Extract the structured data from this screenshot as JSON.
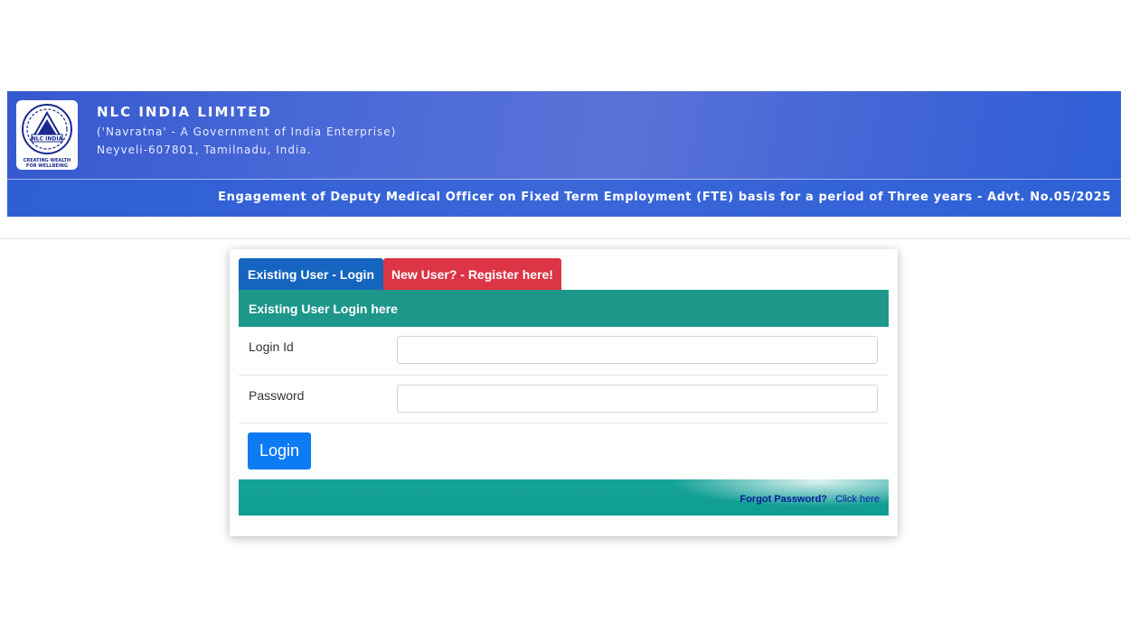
{
  "header": {
    "logo_icon": "nlc-india-logo",
    "logo_text": "NLC INDIA",
    "logo_tagline_top": "CREATING WEALTH",
    "logo_tagline_bottom": "FOR WELLBEING",
    "org_name": "NLC INDIA LIMITED",
    "org_subtitle": "('Navratna' - A Government of India Enterprise)",
    "org_address": "Neyveli-607801, Tamilnadu, India.",
    "advertisement_title": "Engagement of Deputy Medical Officer on Fixed Term Employment (FTE) basis for a period of Three years - Advt. No.05/2025"
  },
  "tabs": [
    {
      "label": "Existing User - Login",
      "active": true,
      "color": "#1565c0"
    },
    {
      "label": "New User? - Register here!",
      "active": false,
      "color": "#dc3545"
    }
  ],
  "login_form": {
    "section_title": "Existing User Login here",
    "login_id_label": "Login Id",
    "login_id_value": "",
    "password_label": "Password",
    "password_value": "",
    "submit_label": "Login"
  },
  "footer": {
    "forgot_label": "Forgot Password?",
    "forgot_link": "Click here"
  },
  "colors": {
    "banner": "#3a62d6",
    "section_head": "#1d978a",
    "login_button": "#0d7bf4",
    "register_tab": "#dc3545"
  }
}
